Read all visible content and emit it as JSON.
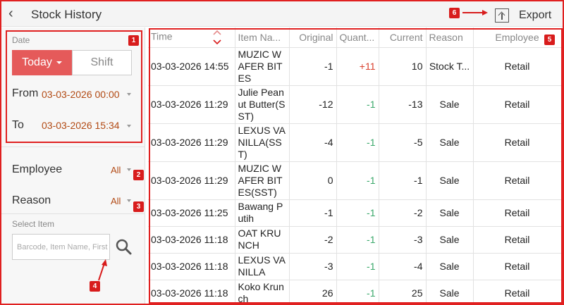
{
  "header": {
    "title": "Stock History",
    "back_icon": "chevron-left-icon",
    "export_label": "Export",
    "export_icon": "export-icon"
  },
  "callouts": [
    "1",
    "2",
    "3",
    "4",
    "5",
    "6"
  ],
  "filters": {
    "date_label": "Date",
    "today_label": "Today",
    "shift_label": "Shift",
    "from_label": "From",
    "from_value": "03-03-2026 00:00",
    "to_label": "To",
    "to_value": "03-03-2026 15:34",
    "employee_label": "Employee",
    "employee_value": "All",
    "reason_label": "Reason",
    "reason_value": "All",
    "select_item_label": "Select Item",
    "search_placeholder": "Barcode, Item Name, First",
    "accent_color": "#e55a5a",
    "value_color": "#b24a14"
  },
  "table": {
    "columns": [
      "Time",
      "Item Na...",
      "Original",
      "Quant...",
      "Current",
      "Reason",
      "Employee"
    ],
    "rows": [
      {
        "time": "03-03-2026 14:55",
        "item": "MUZIC WAFER BITES",
        "original": "-1",
        "quantity": "+11",
        "current": "10",
        "reason": "Stock T...",
        "employee": "Retail"
      },
      {
        "time": "03-03-2026 11:29",
        "item": "Julie Peanut Butter(SST)",
        "original": "-12",
        "quantity": "-1",
        "current": "-13",
        "reason": "Sale",
        "employee": "Retail"
      },
      {
        "time": "03-03-2026 11:29",
        "item": "LEXUS VANILLA(SST)",
        "original": "-4",
        "quantity": "-1",
        "current": "-5",
        "reason": "Sale",
        "employee": "Retail"
      },
      {
        "time": "03-03-2026 11:29",
        "item": "MUZIC WAFER BITES(SST)",
        "original": "0",
        "quantity": "-1",
        "current": "-1",
        "reason": "Sale",
        "employee": "Retail"
      },
      {
        "time": "03-03-2026 11:25",
        "item": "Bawang Putih",
        "original": "-1",
        "quantity": "-1",
        "current": "-2",
        "reason": "Sale",
        "employee": "Retail"
      },
      {
        "time": "03-03-2026 11:18",
        "item": "OAT KRUNCH",
        "original": "-2",
        "quantity": "-1",
        "current": "-3",
        "reason": "Sale",
        "employee": "Retail"
      },
      {
        "time": "03-03-2026 11:18",
        "item": "LEXUS VANILLA",
        "original": "-3",
        "quantity": "-1",
        "current": "-4",
        "reason": "Sale",
        "employee": "Retail"
      },
      {
        "time": "03-03-2026 11:18",
        "item": "Koko Krunch",
        "original": "26",
        "quantity": "-1",
        "current": "25",
        "reason": "Sale",
        "employee": "Retail"
      }
    ],
    "positive_color": "#d9412e",
    "negative_color": "#3aa86a"
  }
}
